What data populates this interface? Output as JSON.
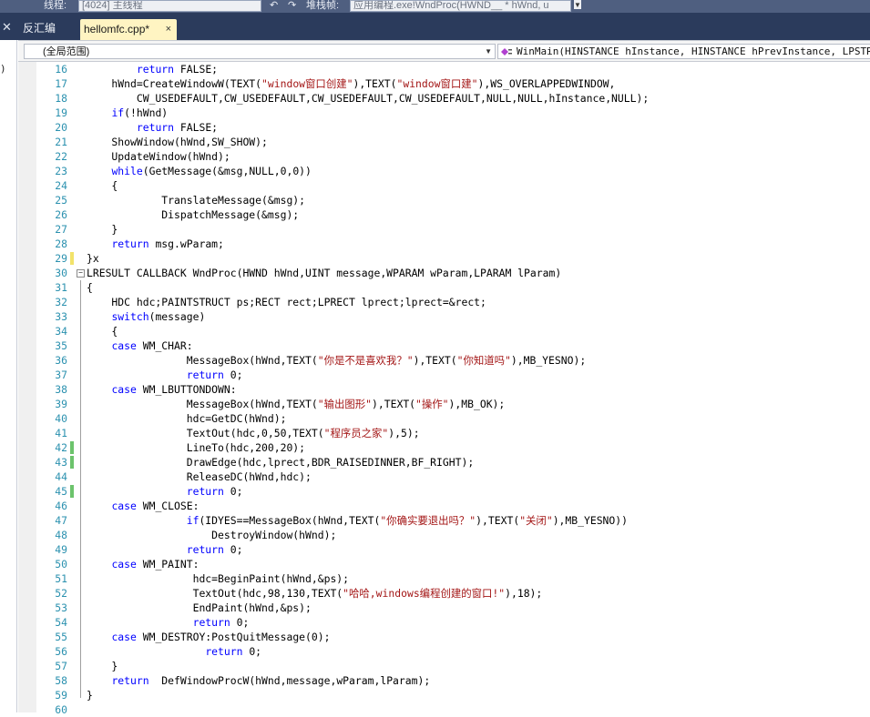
{
  "topbar": {
    "thread_label": "线程:",
    "thread_value": "[4024] 主线程",
    "stack_label": "堆栈帧:",
    "stack_value": "应用编程.exe!WndProc(HWND__ * hWnd, u"
  },
  "tabs": [
    {
      "label": "反汇编",
      "active": false
    },
    {
      "label": "hellomfc.cpp*",
      "active": true
    }
  ],
  "tab_close_glyph": "×",
  "close_x_glyph": "✕",
  "left_strip_text": ")",
  "navbar": {
    "scope_combo": "(全局范围)",
    "function_combo": "WinMain(HINSTANCE hInstance, HINSTANCE hPrevInstance, LPSTR lpCmd"
  },
  "colors": {
    "keyword": "#0000ff",
    "string": "#a31515",
    "line_number": "#2b91af",
    "tab_active_bg": "#fff4c2",
    "tab_strip_bg": "#2b3b5c",
    "changed_saved": "#6cc36c",
    "changed_unsaved": "#f2e36a"
  },
  "icons": {
    "function_combo": "method-icon",
    "dropdown": "chevron-down-icon",
    "fold_toggle": "collapse-minus-icon"
  },
  "lines": [
    {
      "n": "16",
      "text": "        return FALSE;"
    },
    {
      "n": "17",
      "text": "    hWnd=CreateWindowW(TEXT(\"window窗口创建\"),TEXT(\"window窗口建\"),WS_OVERLAPPEDWINDOW,"
    },
    {
      "n": "18",
      "text": "        CW_USEDEFAULT,CW_USEDEFAULT,CW_USEDEFAULT,CW_USEDEFAULT,NULL,NULL,hInstance,NULL);"
    },
    {
      "n": "19",
      "text": "    if(!hWnd)"
    },
    {
      "n": "20",
      "text": "        return FALSE;"
    },
    {
      "n": "21",
      "text": "    ShowWindow(hWnd,SW_SHOW);"
    },
    {
      "n": "22",
      "text": "    UpdateWindow(hWnd);"
    },
    {
      "n": "23",
      "text": "    while(GetMessage(&msg,NULL,0,0))"
    },
    {
      "n": "24",
      "text": "    {"
    },
    {
      "n": "25",
      "text": "            TranslateMessage(&msg);"
    },
    {
      "n": "26",
      "text": "            DispatchMessage(&msg);"
    },
    {
      "n": "27",
      "text": "    }"
    },
    {
      "n": "28",
      "text": "    return msg.wParam;"
    },
    {
      "n": "29",
      "text": "}x",
      "mark": "unsaved"
    },
    {
      "n": "30",
      "text": "LRESULT CALLBACK WndProc(HWND hWnd,UINT message,WPARAM wParam,LPARAM lParam)",
      "fold": true
    },
    {
      "n": "31",
      "text": "{"
    },
    {
      "n": "32",
      "text": "    HDC hdc;PAINTSTRUCT ps;RECT rect;LPRECT lprect;lprect=&rect;"
    },
    {
      "n": "33",
      "text": "    switch(message)"
    },
    {
      "n": "34",
      "text": "    {"
    },
    {
      "n": "35",
      "text": "    case WM_CHAR:"
    },
    {
      "n": "36",
      "text": "                MessageBox(hWnd,TEXT(\"你是不是喜欢我？\"),TEXT(\"你知道吗\"),MB_YESNO);"
    },
    {
      "n": "37",
      "text": "                return 0;"
    },
    {
      "n": "38",
      "text": "    case WM_LBUTTONDOWN:"
    },
    {
      "n": "39",
      "text": "                MessageBox(hWnd,TEXT(\"输出图形\"),TEXT(\"操作\"),MB_OK);"
    },
    {
      "n": "40",
      "text": "                hdc=GetDC(hWnd);"
    },
    {
      "n": "41",
      "text": "                TextOut(hdc,0,50,TEXT(\"程序员之家\"),5);"
    },
    {
      "n": "42",
      "text": "                LineTo(hdc,200,20);",
      "mark": "saved"
    },
    {
      "n": "43",
      "text": "                DrawEdge(hdc,lprect,BDR_RAISEDINNER,BF_RIGHT);",
      "mark": "saved"
    },
    {
      "n": "44",
      "text": "                ReleaseDC(hWnd,hdc);"
    },
    {
      "n": "45",
      "text": "                return 0;",
      "mark": "saved"
    },
    {
      "n": "46",
      "text": "    case WM_CLOSE:"
    },
    {
      "n": "47",
      "text": "                if(IDYES==MessageBox(hWnd,TEXT(\"你确实要退出吗？\"),TEXT(\"关闭\"),MB_YESNO))"
    },
    {
      "n": "48",
      "text": "                    DestroyWindow(hWnd);"
    },
    {
      "n": "49",
      "text": "                return 0;"
    },
    {
      "n": "50",
      "text": "    case WM_PAINT:"
    },
    {
      "n": "51",
      "text": "                 hdc=BeginPaint(hWnd,&ps);"
    },
    {
      "n": "52",
      "text": "                 TextOut(hdc,98,130,TEXT(\"哈哈,windows编程创建的窗口!\"),18);"
    },
    {
      "n": "53",
      "text": "                 EndPaint(hWnd,&ps);"
    },
    {
      "n": "54",
      "text": "                 return 0;"
    },
    {
      "n": "55",
      "text": "    case WM_DESTROY:PostQuitMessage(0);"
    },
    {
      "n": "56",
      "text": "                   return 0;"
    },
    {
      "n": "57",
      "text": "    }"
    },
    {
      "n": "58",
      "text": "    return  DefWindowProcW(hWnd,message,wParam,lParam);"
    },
    {
      "n": "59",
      "text": "}"
    },
    {
      "n": "60",
      "text": ""
    }
  ]
}
